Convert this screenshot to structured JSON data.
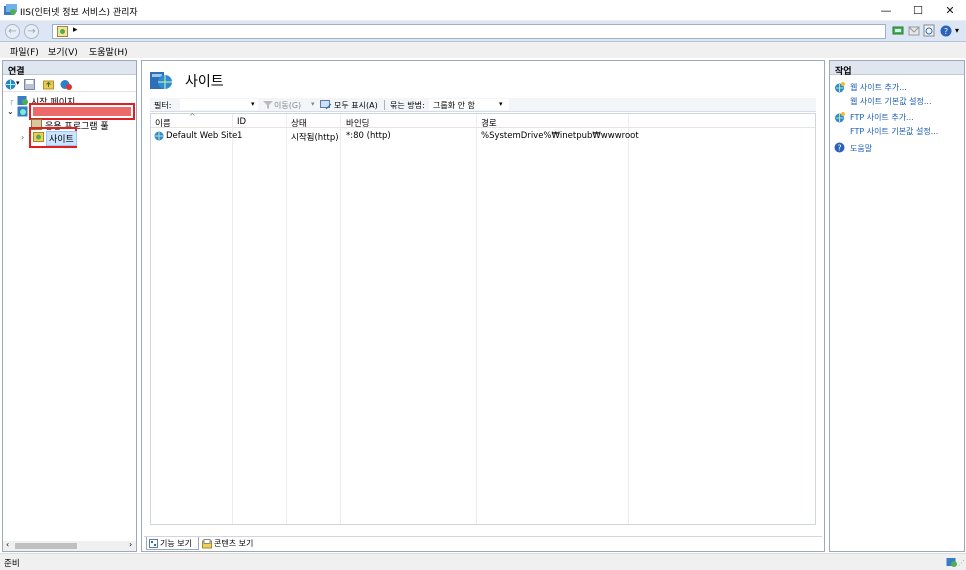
{
  "window": {
    "title": "IIS(인터넷 정보 서비스) 관리자",
    "controls": [
      "—",
      "☐",
      "✕"
    ]
  },
  "address": {
    "separator": "▸"
  },
  "menu": {
    "file": "파일(F)",
    "view": "보기(V)",
    "help": "도움말(H)"
  },
  "connections": {
    "title": "연결",
    "tree": {
      "start_page": "시작 페이지",
      "app_pools": "응용 프로그램 풀",
      "sites": "사이트"
    }
  },
  "main": {
    "title": "사이트",
    "toolbar": {
      "filter_label": "필터:",
      "go_label": "이동(G)",
      "show_all_label": "모두 표시(A)",
      "group_by_label": "묶는 방법:",
      "group_by_value": "그룹화 안 함"
    },
    "columns": {
      "name": "이름",
      "id": "ID",
      "status": "상태",
      "binding": "바인딩",
      "path": "경로"
    },
    "rows": [
      {
        "name": "Default Web Site",
        "id": "1",
        "status": "시작됨(http)",
        "binding": "*:80 (http)",
        "path": "%SystemDrive%₩inetpub₩wwwroot"
      }
    ],
    "view_tabs": {
      "features": "기능 보기",
      "content": "콘텐츠 보기"
    }
  },
  "actions": {
    "title": "작업",
    "add_web_site": "웹 사이트 추가...",
    "web_site_defaults": "웹 사이트 기본값 설정...",
    "add_ftp_site": "FTP 사이트 추가...",
    "ftp_site_defaults": "FTP 사이트 기본값 설정...",
    "help": "도움말"
  },
  "status": {
    "text": "준비"
  },
  "colors": {
    "accent_link": "#1a5bb8",
    "highlight_box": "#e02020",
    "pane_header": "#dfe6f0"
  }
}
